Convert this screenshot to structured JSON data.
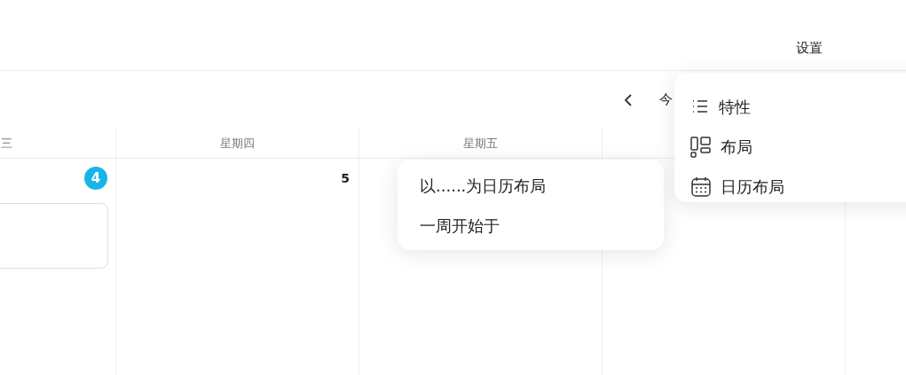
{
  "top_bar": {
    "settings_label": "设置"
  },
  "toolbar": {
    "today_label": "今"
  },
  "days": [
    {
      "weekday": "三",
      "date": "4",
      "today": true,
      "events": [
        {
          "kind": "block"
        }
      ]
    },
    {
      "weekday": "星期四",
      "date": "5",
      "today": false
    },
    {
      "weekday": "星期五"
    }
  ],
  "main_menu": {
    "items": [
      {
        "kind": "list",
        "label": "特性"
      },
      {
        "kind": "layout",
        "label": "布局"
      },
      {
        "kind": "calendar",
        "label": "日历布局"
      }
    ]
  },
  "submenu": {
    "items": [
      {
        "label": "以......为日历布局"
      },
      {
        "label": "一周开始于"
      }
    ]
  }
}
